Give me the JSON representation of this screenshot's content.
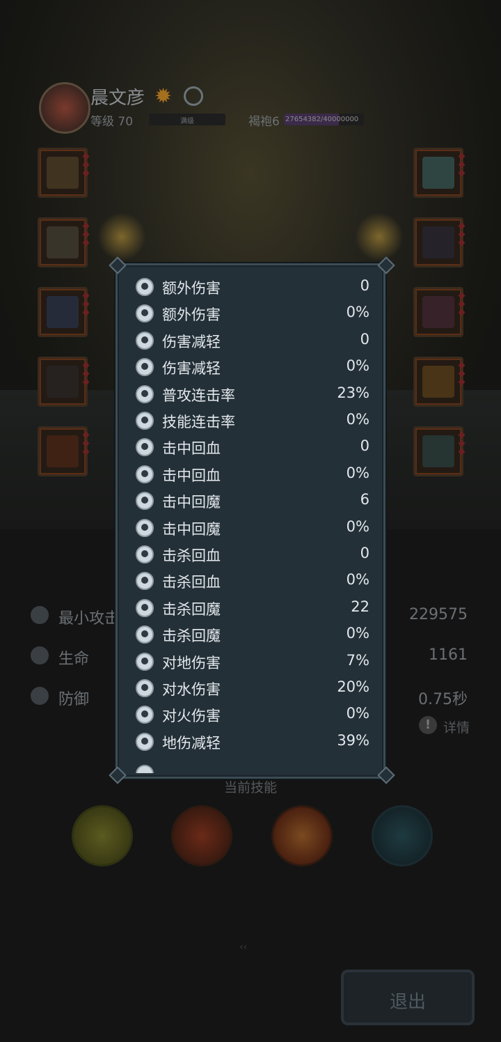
{
  "header": {
    "player_name": "晨文彦",
    "level_label": "等级 70",
    "level_bar_text": "满级",
    "robe_label": "褐袍6",
    "robe_progress_text": "27654382/40000000",
    "robe_progress_fraction": 0.691
  },
  "background_stats": [
    {
      "label": "最小攻击",
      "value": "229575",
      "icon": "attack-icon"
    },
    {
      "label": "生命",
      "value": "1161",
      "icon": "heart-icon"
    },
    {
      "label": "防御",
      "value": "0.75秒",
      "icon": "shield-icon"
    }
  ],
  "detail_label": "详情",
  "skills_title": "当前技能",
  "exit_label": "退出",
  "attribute_popup": {
    "rows": [
      {
        "label": "额外伤害",
        "value": "0"
      },
      {
        "label": "额外伤害",
        "value": "0%"
      },
      {
        "label": "伤害减轻",
        "value": "0"
      },
      {
        "label": "伤害减轻",
        "value": "0%"
      },
      {
        "label": "普攻连击率",
        "value": "23%"
      },
      {
        "label": "技能连击率",
        "value": "0%"
      },
      {
        "label": "击中回血",
        "value": "0"
      },
      {
        "label": "击中回血",
        "value": "0%"
      },
      {
        "label": "击中回魔",
        "value": "6"
      },
      {
        "label": "击中回魔",
        "value": "0%"
      },
      {
        "label": "击杀回血",
        "value": "0"
      },
      {
        "label": "击杀回血",
        "value": "0%"
      },
      {
        "label": "击杀回魔",
        "value": "22"
      },
      {
        "label": "击杀回魔",
        "value": "0%"
      },
      {
        "label": "对地伤害",
        "value": "7%"
      },
      {
        "label": "对水伤害",
        "value": "20%"
      },
      {
        "label": "对火伤害",
        "value": "0%"
      },
      {
        "label": "地伤减轻",
        "value": "39%"
      }
    ]
  },
  "colors": {
    "popup_bg": "#243038",
    "popup_border": "#3d4c55",
    "text": "#e3e8ec"
  }
}
